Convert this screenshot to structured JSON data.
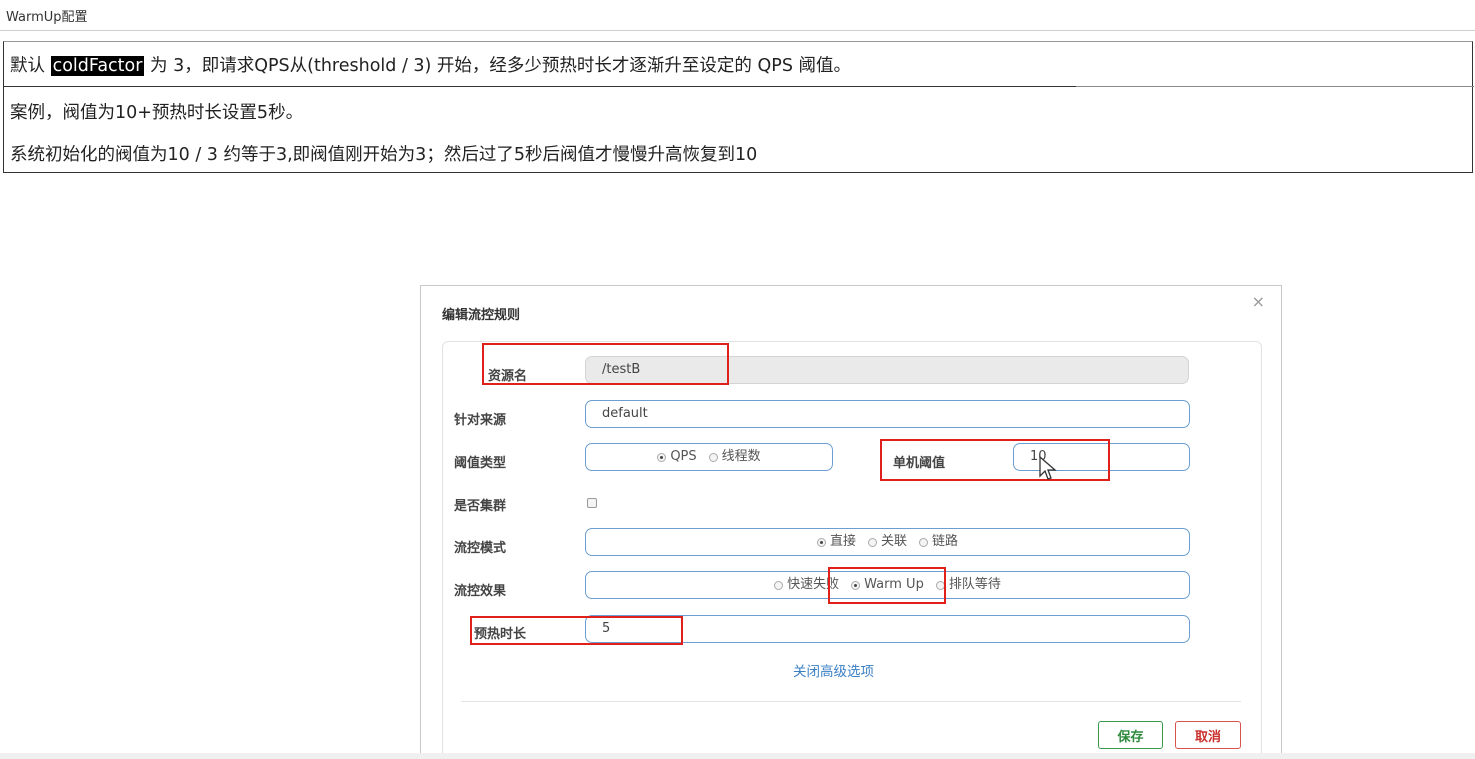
{
  "page": {
    "title": "WarmUp配置"
  },
  "note": {
    "line1_prefix": "默认 ",
    "line1_highlight": "coldFactor",
    "line1_suffix": " 为 3，即请求QPS从(threshold / 3) 开始，经多少预热时长才逐渐升至设定的 QPS 阈值。",
    "line2": "案例，阀值为10+预热时长设置5秒。",
    "line3": "系统初始化的阀值为10 / 3 约等于3,即阀值刚开始为3；然后过了5秒后阀值才慢慢升高恢复到10"
  },
  "dialog": {
    "title": "编辑流控规则",
    "close_glyph": "×",
    "resource": {
      "label": "资源名",
      "value": "/testB"
    },
    "origin": {
      "label": "针对来源",
      "value": "default"
    },
    "threshold_type": {
      "label": "阈值类型",
      "options": [
        "QPS",
        "线程数"
      ],
      "selected": "QPS"
    },
    "threshold": {
      "label": "单机阈值",
      "value": "10"
    },
    "cluster": {
      "label": "是否集群",
      "checked": false
    },
    "mode": {
      "label": "流控模式",
      "options": [
        "直接",
        "关联",
        "链路"
      ],
      "selected": "直接"
    },
    "effect": {
      "label": "流控效果",
      "options": [
        "快速失败",
        "Warm Up",
        "排队等待"
      ],
      "selected": "Warm Up"
    },
    "warmup": {
      "label": "预热时长",
      "value": "5"
    },
    "advanced_link": "关闭高级选项",
    "save_label": "保存",
    "cancel_label": "取消"
  },
  "colors": {
    "highlight_bar": "#e0201a",
    "field_border": "#6b9fd1",
    "link": "#3a7fc4",
    "save": "#2f8a3e",
    "cancel": "#c9302c"
  }
}
